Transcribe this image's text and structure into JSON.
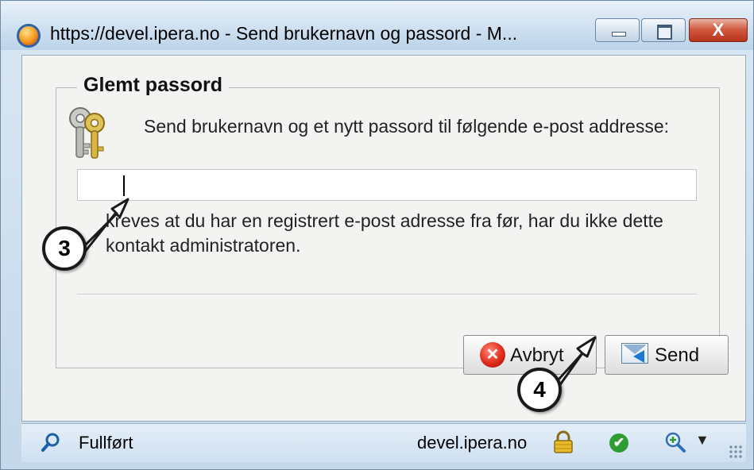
{
  "window": {
    "title": "https://devel.ipera.no - Send brukernavn og passord - M...",
    "app_icon": "firefox-icon",
    "controls": {
      "minimize": "minimize-icon",
      "maximize": "maximize-icon",
      "close_label": "X"
    }
  },
  "dialog": {
    "group_title": "Glemt passord",
    "keys_icon": "keys-icon",
    "intro": "Send brukernavn og et nytt passord til følgende e-post addresse:",
    "email": {
      "value": "",
      "placeholder": ""
    },
    "note": "kreves at du har en registrert e-post adresse fra før, har du ikke dette kontakt administratoren.",
    "buttons": {
      "cancel_label": "Avbryt",
      "cancel_icon": "cancel-icon",
      "send_label": "Send",
      "send_icon": "send-mail-icon"
    }
  },
  "statusbar": {
    "status_text": "Fullført",
    "host": "devel.ipera.no",
    "icons": [
      "search-icon",
      "lock-icon",
      "check-icon",
      "zoom-icon",
      "chevron-down-icon"
    ]
  },
  "callouts": [
    {
      "number": "3"
    },
    {
      "number": "4"
    }
  ],
  "colors": {
    "titlebar": "#cddff0",
    "close_button": "#d15b40",
    "client_bg": "#f3f3f1"
  }
}
